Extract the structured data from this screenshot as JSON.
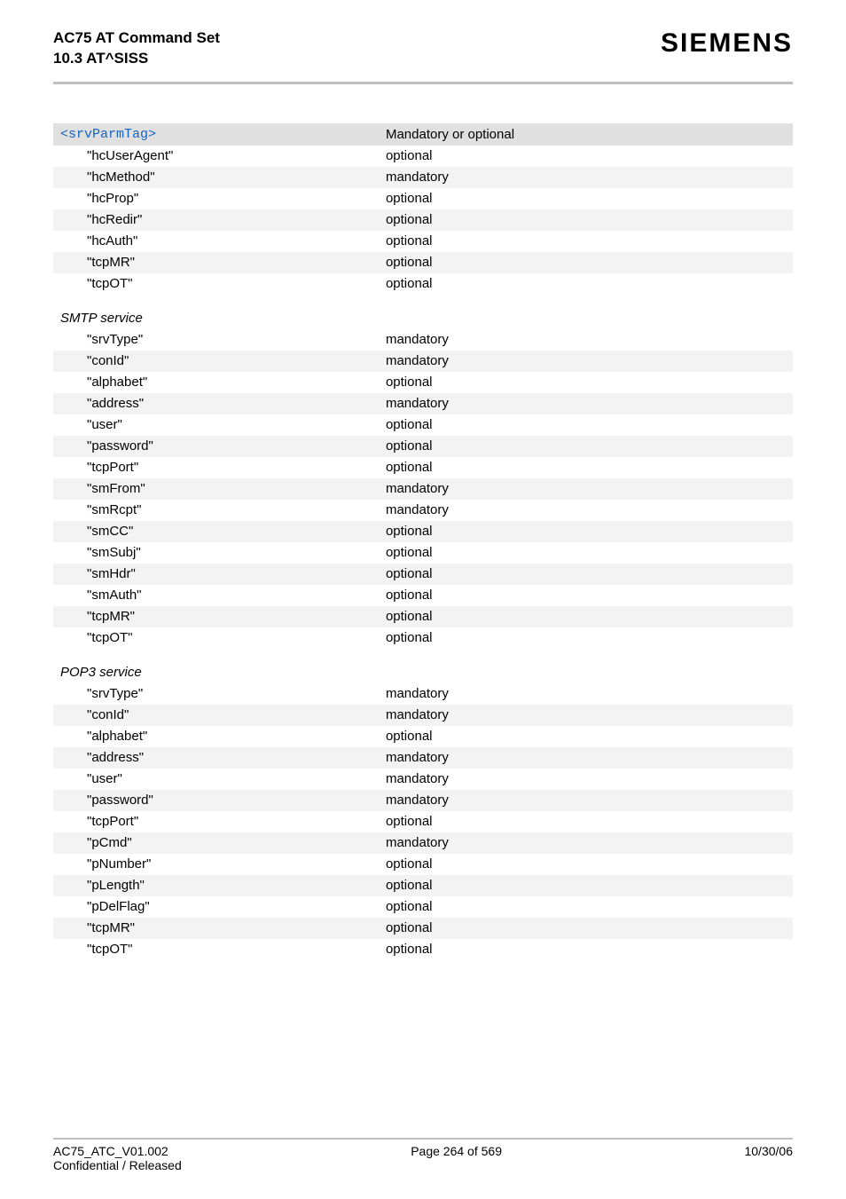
{
  "header": {
    "title_line1": "AC75 AT Command Set",
    "title_line2": "10.3 AT^SISS",
    "brand": "SIEMENS"
  },
  "table": {
    "header": {
      "tag": "<srvParmTag>",
      "val": "Mandatory or optional"
    },
    "section1": {
      "rows": [
        {
          "tag": "\"hcUserAgent\"",
          "val": "optional"
        },
        {
          "tag": "\"hcMethod\"",
          "val": "mandatory"
        },
        {
          "tag": "\"hcProp\"",
          "val": "optional"
        },
        {
          "tag": "\"hcRedir\"",
          "val": "optional"
        },
        {
          "tag": "\"hcAuth\"",
          "val": "optional"
        },
        {
          "tag": "\"tcpMR\"",
          "val": "optional"
        },
        {
          "tag": "\"tcpOT\"",
          "val": "optional"
        }
      ]
    },
    "section2": {
      "title": "SMTP service",
      "rows": [
        {
          "tag": "\"srvType\"",
          "val": "mandatory"
        },
        {
          "tag": "\"conId\"",
          "val": "mandatory"
        },
        {
          "tag": "\"alphabet\"",
          "val": "optional"
        },
        {
          "tag": "\"address\"",
          "val": "mandatory"
        },
        {
          "tag": "\"user\"",
          "val": "optional"
        },
        {
          "tag": "\"password\"",
          "val": "optional"
        },
        {
          "tag": "\"tcpPort\"",
          "val": "optional"
        },
        {
          "tag": "\"smFrom\"",
          "val": "mandatory"
        },
        {
          "tag": "\"smRcpt\"",
          "val": "mandatory"
        },
        {
          "tag": "\"smCC\"",
          "val": "optional"
        },
        {
          "tag": "\"smSubj\"",
          "val": "optional"
        },
        {
          "tag": "\"smHdr\"",
          "val": "optional"
        },
        {
          "tag": "\"smAuth\"",
          "val": "optional"
        },
        {
          "tag": "\"tcpMR\"",
          "val": "optional"
        },
        {
          "tag": "\"tcpOT\"",
          "val": "optional"
        }
      ]
    },
    "section3": {
      "title": "POP3 service",
      "rows": [
        {
          "tag": "\"srvType\"",
          "val": "mandatory"
        },
        {
          "tag": "\"conId\"",
          "val": "mandatory"
        },
        {
          "tag": "\"alphabet\"",
          "val": "optional"
        },
        {
          "tag": "\"address\"",
          "val": "mandatory"
        },
        {
          "tag": "\"user\"",
          "val": "mandatory"
        },
        {
          "tag": "\"password\"",
          "val": "mandatory"
        },
        {
          "tag": "\"tcpPort\"",
          "val": "optional"
        },
        {
          "tag": "\"pCmd\"",
          "val": "mandatory"
        },
        {
          "tag": "\"pNumber\"",
          "val": "optional"
        },
        {
          "tag": "\"pLength\"",
          "val": "optional"
        },
        {
          "tag": "\"pDelFlag\"",
          "val": "optional"
        },
        {
          "tag": "\"tcpMR\"",
          "val": "optional"
        },
        {
          "tag": "\"tcpOT\"",
          "val": "optional"
        }
      ]
    }
  },
  "footer": {
    "left": "AC75_ATC_V01.002",
    "center": "Page 264 of 569",
    "right": "10/30/06",
    "left2": "Confidential / Released"
  }
}
